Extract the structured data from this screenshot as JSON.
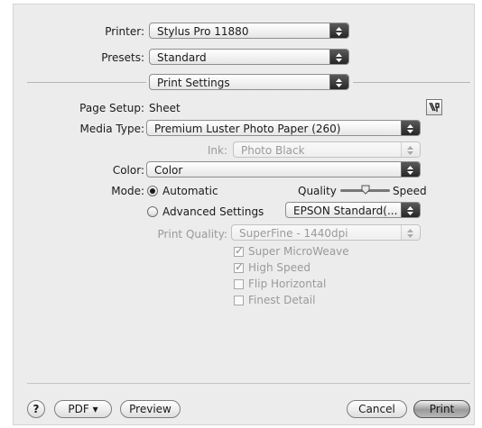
{
  "printer": {
    "label": "Printer:",
    "value": "Stylus Pro 11880"
  },
  "presets": {
    "label": "Presets:",
    "value": "Standard"
  },
  "panel_popup": {
    "value": "Print Settings"
  },
  "page_setup": {
    "label": "Page Setup:",
    "value": "Sheet"
  },
  "media_type": {
    "label": "Media Type:",
    "value": "Premium Luster Photo Paper (260)"
  },
  "ink": {
    "label": "Ink:",
    "value": "Photo Black"
  },
  "color": {
    "label": "Color:",
    "value": "Color"
  },
  "mode": {
    "label": "Mode:",
    "automatic_label": "Automatic",
    "advanced_label": "Advanced Settings",
    "selected": "automatic",
    "quality_label": "Quality",
    "speed_label": "Speed",
    "slider_level": 0.5,
    "advanced_preset": "EPSON Standard(..."
  },
  "print_quality": {
    "label": "Print Quality:",
    "value": "SuperFine - 1440dpi"
  },
  "checkboxes": [
    {
      "label": "Super MicroWeave",
      "checked": true
    },
    {
      "label": "High Speed",
      "checked": true
    },
    {
      "label": "Flip Horizontal",
      "checked": false
    },
    {
      "label": "Finest Detail",
      "checked": false
    }
  ],
  "footer": {
    "help": "?",
    "pdf": "PDF ▾",
    "preview": "Preview",
    "cancel": "Cancel",
    "print": "Print"
  }
}
